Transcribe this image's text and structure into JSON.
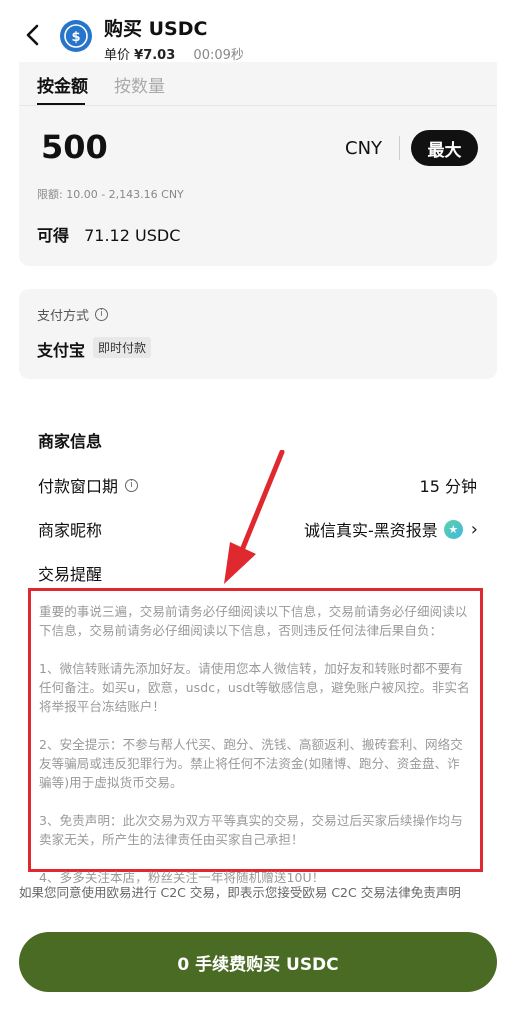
{
  "header": {
    "title": "购买 USDC",
    "price_label": "单价",
    "price_value": "¥7.03",
    "timer": "00:09秒",
    "coin_icon": "usdc-coin-icon"
  },
  "order": {
    "tabs": [
      {
        "label": "按金额",
        "active": true
      },
      {
        "label": "按数量",
        "active": false
      }
    ],
    "amount": "500",
    "currency": "CNY",
    "max_label": "最大",
    "limit_text": "限额: 10.00 - 2,143.16 CNY",
    "receive_label": "可得",
    "receive_value": "71.12 USDC"
  },
  "payment": {
    "label": "支付方式",
    "method": "支付宝",
    "tag": "即时付款"
  },
  "merchant": {
    "title": "商家信息",
    "window_label": "付款窗口期",
    "window_value": "15 分钟",
    "nickname_label": "商家昵称",
    "nickname_value": "诚信真实-黑资报景",
    "reminder_label": "交易提醒"
  },
  "notice": {
    "paragraphs": [
      "重要的事说三遍，交易前请务必仔细阅读以下信息，交易前请务必仔细阅读以下信息，交易前请务必仔细阅读以下信息，否则违反任何法律后果自负：",
      "1、微信转账请先添加好友。请使用您本人微信转，加好友和转账时都不要有任何备注。如买u，欧意，usdc，usdt等敏感信息，避免账户被风控。非实名将举报平台冻结账户！",
      "2、安全提示：不参与帮人代买、跑分、洗钱、高额返利、搬砖套利、网络交友等骗局或违反犯罪行为。禁止将任何不法资金(如赌博、跑分、资金盘、诈骗等)用于虚拟货币交易。",
      "3、免责声明：此次交易为双方平等真实的交易，交易过后买家后续操作均与卖家无关，所产生的法律责任由买家自己承担！",
      "4、多多关注本店，粉丝关注一年将随机赠送10U！"
    ],
    "highlight_color": "#e0292e"
  },
  "disclaimer": "如果您同意使用欧易进行 C2C 交易，即表示您接受欧易 C2C 交易法律免责声明",
  "buy_button": "0 手续费购买 USDC",
  "colors": {
    "buy_button": "#4a6b24",
    "card_bg": "#f5f5f5",
    "usdc_blue": "#2775ca"
  }
}
